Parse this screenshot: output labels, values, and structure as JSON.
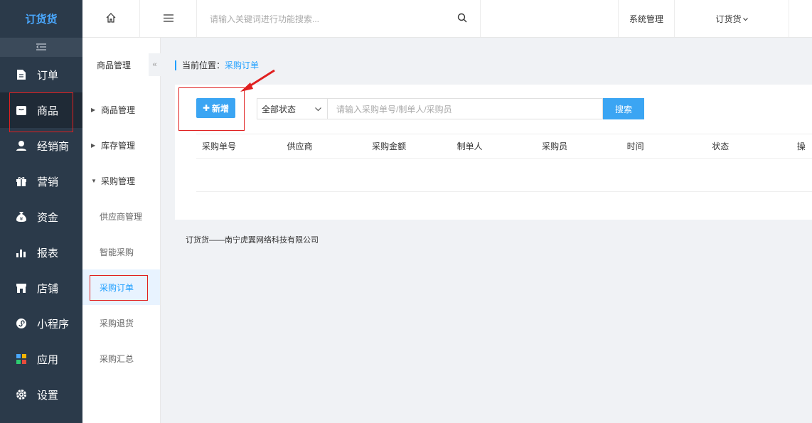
{
  "logo": {
    "text": "订货货"
  },
  "sidebar": {
    "collapse_icon": "collapse-icon",
    "items": [
      {
        "label": "订单",
        "icon": "document-icon"
      },
      {
        "label": "商品",
        "icon": "product-icon",
        "active": true
      },
      {
        "label": "经销商",
        "icon": "user-icon"
      },
      {
        "label": "营销",
        "icon": "gift-icon"
      },
      {
        "label": "资金",
        "icon": "money-bag-icon"
      },
      {
        "label": "报表",
        "icon": "bar-chart-icon"
      },
      {
        "label": "店铺",
        "icon": "store-icon"
      },
      {
        "label": "小程序",
        "icon": "mini-program-icon"
      },
      {
        "label": "应用",
        "icon": "apps-icon"
      },
      {
        "label": "设置",
        "icon": "gear-icon"
      }
    ]
  },
  "topbar": {
    "search_placeholder": "请输入关键词进行功能搜索...",
    "system_label": "系统管理",
    "user_label": "订货货"
  },
  "submenu": {
    "title": "商品管理",
    "groups": [
      {
        "label": "商品管理",
        "expanded": false
      },
      {
        "label": "库存管理",
        "expanded": false
      },
      {
        "label": "采购管理",
        "expanded": true
      }
    ],
    "children": [
      {
        "label": "供应商管理"
      },
      {
        "label": "智能采购"
      },
      {
        "label": "采购订单",
        "active": true
      },
      {
        "label": "采购退货"
      },
      {
        "label": "采购汇总"
      }
    ]
  },
  "main": {
    "breadcrumb_prefix": "当前位置：",
    "breadcrumb_current": "采购订单",
    "add_button": "新增",
    "status_select": "全部状态",
    "search_placeholder": "请输入采购单号/制单人/采购员",
    "search_button": "搜索",
    "columns": [
      "采购单号",
      "供应商",
      "采购金额",
      "制单人",
      "采购员",
      "时间",
      "状态",
      "操"
    ],
    "footer": "订货货——南宁虎翼网络科技有限公司"
  },
  "colors": {
    "sidebar_bg": "#2b3a4a",
    "accent": "#3ba5f3",
    "highlight": "#e02020"
  }
}
